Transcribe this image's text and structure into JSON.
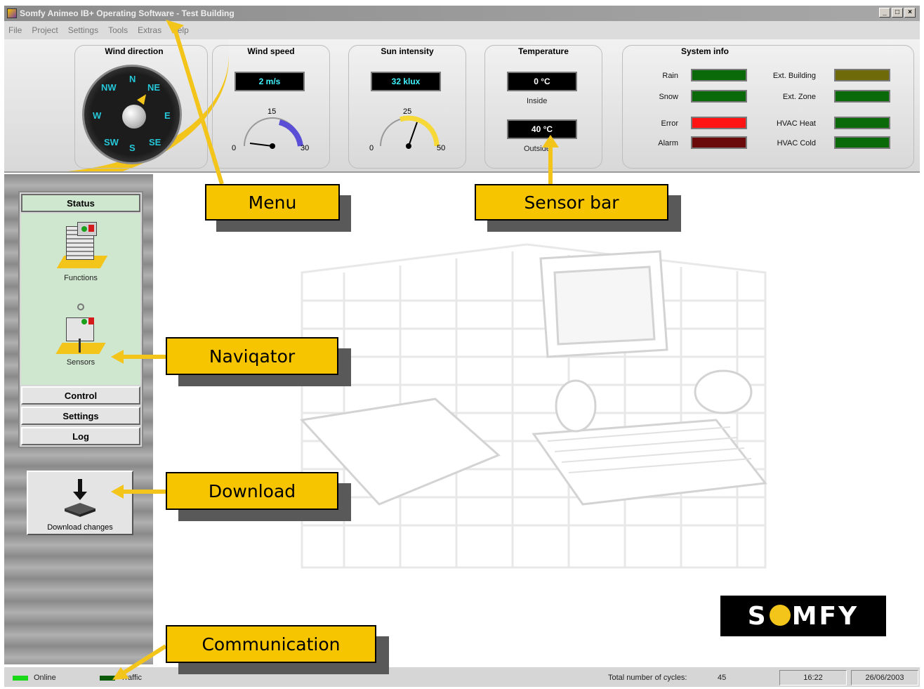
{
  "window": {
    "title": "Somfy Animeo IB+ Operating Software - Test Building",
    "controls": [
      "_",
      "□",
      "×"
    ]
  },
  "menu": {
    "items": [
      "File",
      "Project",
      "Settings",
      "Tools",
      "Extras",
      "Help"
    ]
  },
  "sensors": {
    "wind_direction": {
      "title": "Wind direction",
      "labels": [
        "N",
        "NE",
        "E",
        "SE",
        "S",
        "SW",
        "W",
        "NW"
      ],
      "icon": "compass-icon"
    },
    "wind_speed": {
      "title": "Wind speed",
      "value": "2 m/s",
      "gauge_min": "0",
      "gauge_mid": "15",
      "gauge_max": "30",
      "gauge_level": 2
    },
    "sun_intensity": {
      "title": "Sun intensity",
      "value": "32 klux",
      "gauge_min": "0",
      "gauge_mid": "25",
      "gauge_max": "50",
      "gauge_level": 32
    },
    "temperature": {
      "title": "Temperature",
      "inside_value": "0 °C",
      "inside_label": "Inside",
      "outside_value": "40 °C",
      "outside_label": "Outside"
    },
    "system_info": {
      "title": "System info",
      "indicators": [
        {
          "label": "Rain",
          "color": "#0a6a0a"
        },
        {
          "label": "Snow",
          "color": "#0a6a0a"
        },
        {
          "label": "Error",
          "color": "#ff1414"
        },
        {
          "label": "Alarm",
          "color": "#6a0a0a"
        },
        {
          "label": "Ext. Building",
          "color": "#6e6a0a"
        },
        {
          "label": "Ext. Zone",
          "color": "#0a6a0a"
        },
        {
          "label": "HVAC Heat",
          "color": "#0a6a0a"
        },
        {
          "label": "HVAC Cold",
          "color": "#0a6a0a"
        }
      ]
    }
  },
  "navigator": {
    "header": "Status",
    "items": [
      {
        "label": "Functions",
        "icon": "building-functions-icon"
      },
      {
        "label": "Sensors",
        "icon": "building-sensors-icon"
      }
    ],
    "buttons": [
      "Control",
      "Settings",
      "Log"
    ]
  },
  "download": {
    "label": "Download changes",
    "icon": "download-arrow-icon"
  },
  "logo": {
    "text_left": "S",
    "text_right": "MFY",
    "accent": "#f3c51a"
  },
  "statusbar": {
    "online_label": "Online",
    "traffic_label": "Traffic",
    "cycles_label": "Total number of cycles:",
    "cycles_value": "45",
    "time": "16:22",
    "date": "26/06/2003"
  },
  "callouts": {
    "menu": "Menu",
    "sensor_bar": "Sensor bar",
    "navigator": "Naviqator",
    "download": "Download",
    "communication": "Communication"
  },
  "colors": {
    "accent": "#f3c51a",
    "callout": "#f6c500",
    "lcd_text": "#3ff4ff"
  }
}
